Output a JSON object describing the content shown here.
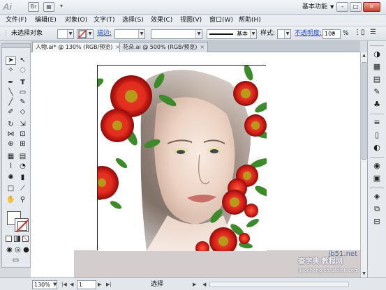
{
  "app": {
    "logo_text": "Ai",
    "workspace": "基本功能"
  },
  "menu": [
    "文件(F)",
    "编辑(E)",
    "对象(O)",
    "文字(T)",
    "选择(S)",
    "效果(C)",
    "视图(V)",
    "窗口(W)",
    "帮助(H)"
  ],
  "controlbar": {
    "selection_label": "未选择对象",
    "stroke_label": "描边:",
    "brush_label": "基本",
    "style_label": "样式:",
    "opacity_label": "不透明度:",
    "opacity_value": "100",
    "opacity_unit": "%"
  },
  "tabs": [
    {
      "label": "人物.ai* @ 130% (RGB/预览)",
      "close": "×"
    },
    {
      "label": "花朵.ai @ 500% (RGB/预览)",
      "close": "×"
    }
  ],
  "status": {
    "zoom": "130%",
    "page": "1",
    "tool_name": "选择"
  },
  "watermark": {
    "line1": "jb51.net",
    "line2": "查字典 教程网",
    "line3": "jiaocheng.chazidian.com"
  },
  "colors": {
    "flower_red": "#d42018",
    "leaf_green": "#3d8a2a",
    "selection_blue": "#1d4fd0"
  }
}
